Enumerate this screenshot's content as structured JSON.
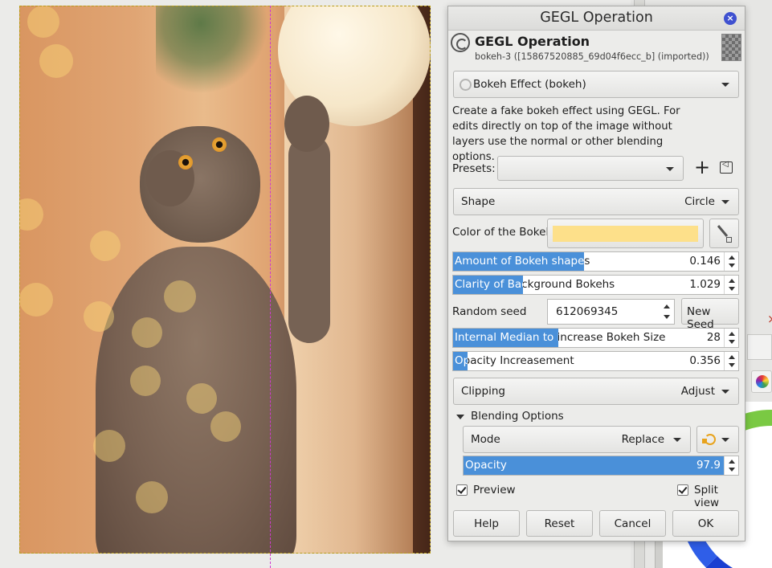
{
  "dialog": {
    "window_title": "GEGL Operation",
    "header_name": "GEGL Operation",
    "header_sub": "bokeh-3 ([15867520885_69d04f6ecc_b] (imported))",
    "operation": "Bokeh Effect (bokeh)",
    "description": "Create a fake bokeh effect using GEGL. For edits directly on top of the image without layers use the normal or other blending options.",
    "presets_label": "Presets:",
    "presets_value": "",
    "shape_label": "Shape",
    "shape_value": "Circle",
    "color_label": "Color of the Bokeh",
    "color_value": "#fde08a",
    "amount": {
      "label": "Amount of Bokeh shapes",
      "value": "0.146",
      "fill": 0.46
    },
    "clarity": {
      "label": "Clarity of Background Bokehs",
      "value": "1.029",
      "fill": 0.245
    },
    "seed_label": "Random seed",
    "seed_value": "612069345",
    "new_seed_label": "New Seed",
    "median": {
      "label": "Internal Median to increase Bokeh Size",
      "value": "28",
      "fill": 0.37
    },
    "opacity_inc": {
      "label": "Opacity Increasement",
      "value": "0.356",
      "fill": 0.05
    },
    "clipping_label": "Clipping",
    "clipping_value": "Adjust",
    "blending_header": "Blending Options",
    "mode_label": "Mode",
    "mode_value": "Replace",
    "opacity": {
      "label": "Opacity",
      "value": "97.9",
      "fill": 0.979
    },
    "preview_label": "Preview",
    "split_label": "Split view",
    "buttons": {
      "help": "Help",
      "reset": "Reset",
      "cancel": "Cancel",
      "ok": "OK"
    }
  },
  "accent_color": "#4a90d9",
  "icons": [
    "close-icon",
    "gegl-logo-icon",
    "add-preset-icon",
    "preset-menu-icon",
    "color-picker-icon",
    "mode-switch-icon",
    "color-wheel-icon"
  ]
}
